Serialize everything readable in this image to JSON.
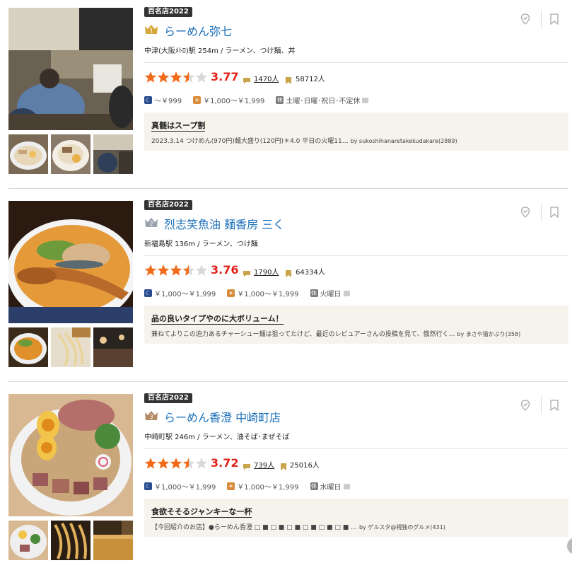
{
  "colors": {
    "title": "#1b6fb9",
    "score": "#e2231a",
    "star": "#f26b1a",
    "badge": "#333333"
  },
  "restaurants": [
    {
      "badge": "百名店2022",
      "rank": "1",
      "name": "らーめん弥七",
      "station_genre": "中津(大阪ﾒﾄﾛ)駅 254m / ラーメン、つけ麺、丼",
      "rating": 3.77,
      "rating_text": "3.77",
      "reviews": "1470人",
      "saves": "58712人",
      "dinner_price": "～￥999",
      "lunch_price": "￥1,000～￥1,999",
      "holiday": "土曜･日曜･祝日･不定休",
      "review_title": "真髄はスープ割",
      "review_body": "2023.3.14 つけめん(970円)麺大盛り(120円)＊4.0 平日の火曜11…",
      "review_by": "by sukoshihanaretakekudakare(2889)"
    },
    {
      "badge": "百名店2022",
      "rank": "2",
      "name": "烈志笑魚油 麺香房 三く",
      "station_genre": "新福島駅 136m / ラーメン、つけ麺",
      "rating": 3.76,
      "rating_text": "3.76",
      "reviews": "1790人",
      "saves": "64334人",
      "dinner_price": "￥1,000～￥1,999",
      "lunch_price": "￥1,000～￥1,999",
      "holiday": "火曜日",
      "review_title": "品の良いタイプやのに大ボリューム！",
      "review_body": "兼ねてよりこの迫力あるチャーシュー麺は狙ってたけど、最近のレビュアーさんの投稿を見て、俄然行く…",
      "review_by": "by まさや猫かぶり(358)"
    },
    {
      "badge": "百名店2022",
      "rank": "3",
      "name": "らーめん香澄 中崎町店",
      "station_genre": "中崎町駅 246m / ラーメン、油そば･まぜそば",
      "rating": 3.72,
      "rating_text": "3.72",
      "reviews": "739人",
      "saves": "25016人",
      "dinner_price": "￥1,000～￥1,999",
      "lunch_price": "￥1,000～￥1,999",
      "holiday": "水曜日",
      "review_title": "食欲そそるジャンキーな一杯",
      "review_body": "【今回紹介のお店】●らーめん香澄 □ ■ □ ■ □ ■ □ ■ □ ■ □ ■ …",
      "review_by": "by ゲルスタ@視独のグルメ(431)"
    }
  ]
}
